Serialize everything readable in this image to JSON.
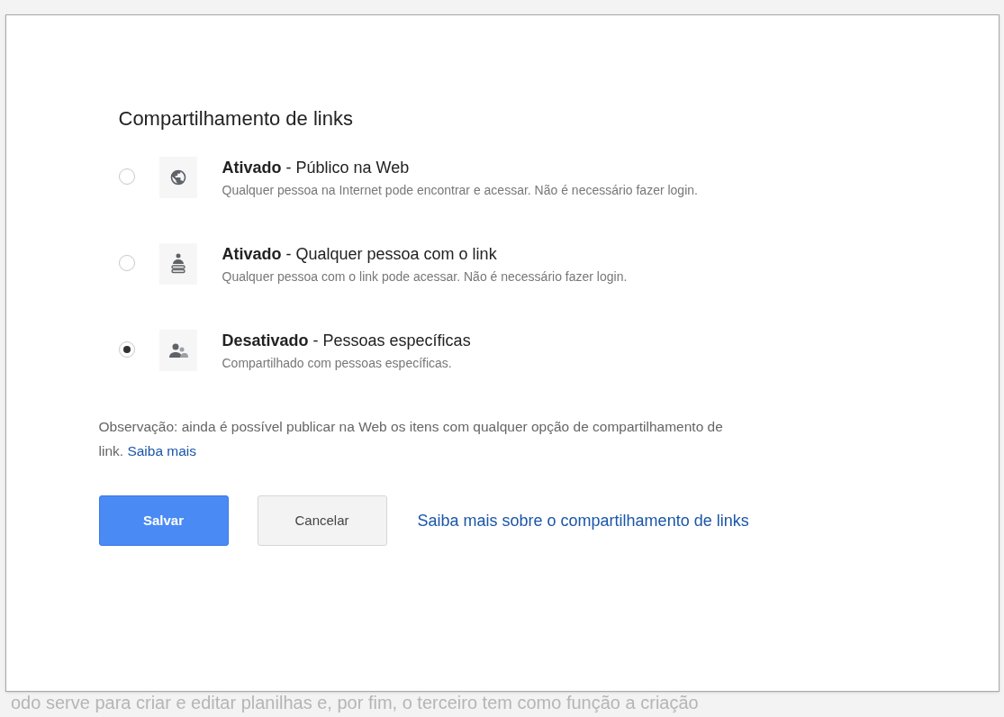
{
  "dialog": {
    "title": "Compartilhamento de links",
    "options": [
      {
        "kind": "globe",
        "title_bold": "Ativado",
        "title_rest": " - Público na Web",
        "description": "Qualquer pessoa na Internet pode encontrar e acessar. Não é necessário fazer login.",
        "selected": false
      },
      {
        "kind": "link-person",
        "title_bold": "Ativado",
        "title_rest": " - Qualquer pessoa com o link",
        "description": "Qualquer pessoa com o link pode acessar. Não é necessário fazer login.",
        "selected": false
      },
      {
        "kind": "people",
        "title_bold": "Desativado",
        "title_rest": " - Pessoas específicas",
        "description": "Compartilhado com pessoas específicas.",
        "selected": true
      }
    ],
    "note": "Observação: ainda é possível publicar na Web os itens com qualquer opção de compartilhamento de link.",
    "note_link": "Saiba mais",
    "buttons": [
      {
        "label": "Salvar",
        "kind": "primary"
      },
      {
        "label": "Cancelar",
        "kind": "secondary"
      }
    ],
    "help_link": "Saiba mais sobre o compartilhamento de links"
  },
  "background_text": "odo serve para criar e editar planilhas e, por fim, o terceiro tem como função a criação"
}
